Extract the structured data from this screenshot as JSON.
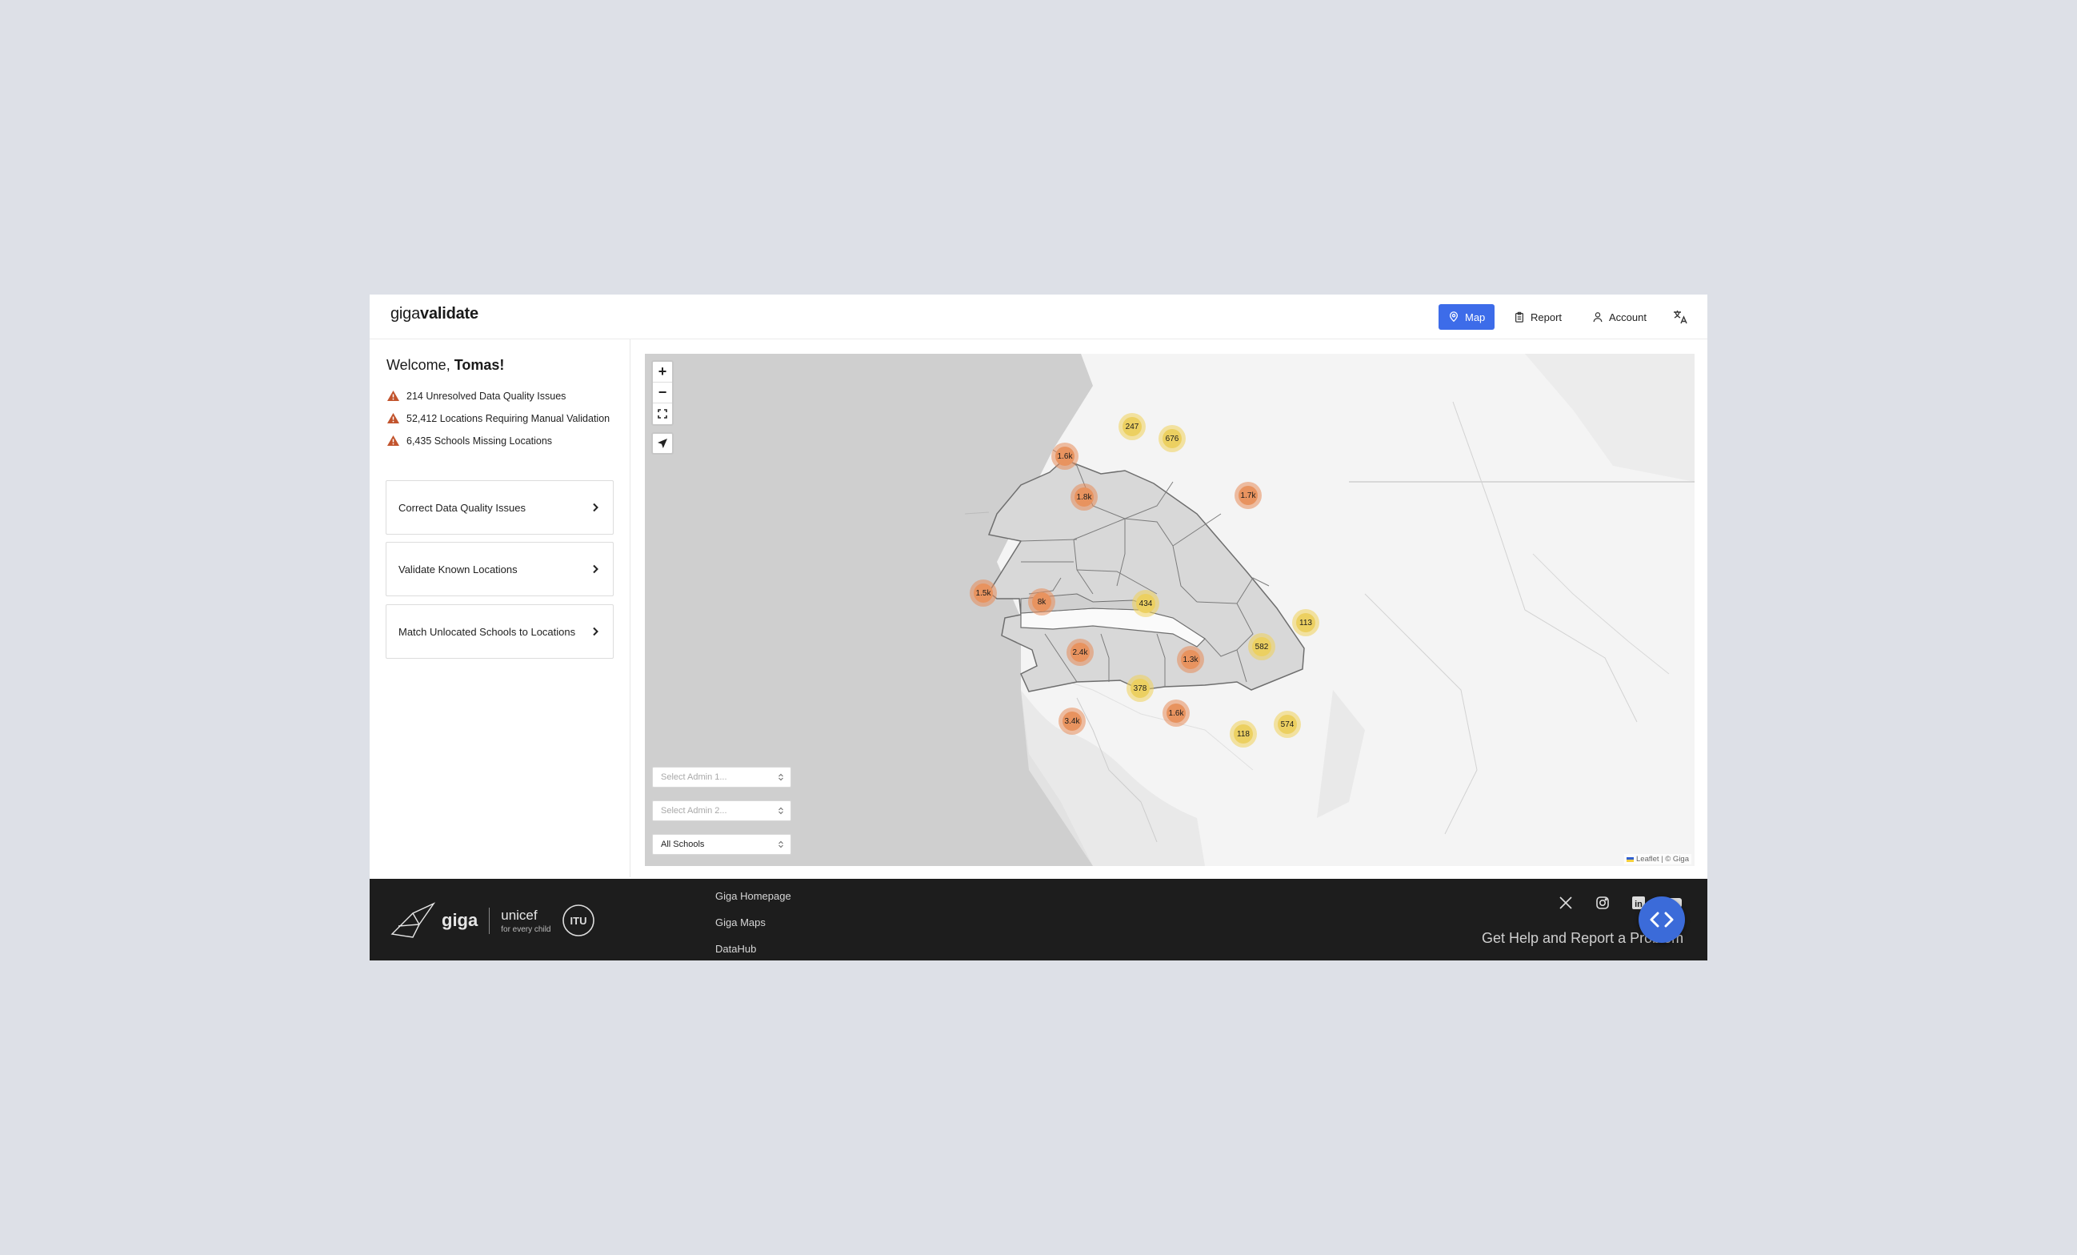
{
  "header": {
    "logo_light": "giga",
    "logo_bold": "validate",
    "nav": [
      {
        "label": "Map",
        "icon": "map-icon",
        "active": true
      },
      {
        "label": "Report",
        "icon": "clipboard-icon"
      },
      {
        "label": "Account",
        "icon": "user-icon"
      }
    ],
    "language_icon": "translate-icon",
    "accent_color": "#3d6ce9"
  },
  "sidebar": {
    "welcome_prefix": "Welcome,",
    "user_name": "Tomas!",
    "alerts": [
      "214 Unresolved Data Quality Issues",
      "52,412 Locations Requiring Manual Validation",
      "6,435 Schools Missing Locations"
    ],
    "alert_color": "#c2542d",
    "tasks": [
      "Correct Data Quality Issues",
      "Validate Known Locations",
      "Match Unlocated Schools to Locations"
    ]
  },
  "map": {
    "zoom_in": "+",
    "zoom_out": "−",
    "clusters": [
      {
        "label": "247",
        "color": "yellow"
      },
      {
        "label": "676",
        "color": "yellow"
      },
      {
        "label": "1.6k",
        "color": "orange"
      },
      {
        "label": "1.8k",
        "color": "orange"
      },
      {
        "label": "1.7k",
        "color": "orange"
      },
      {
        "label": "1.5k",
        "color": "orange"
      },
      {
        "label": "8k",
        "color": "orange"
      },
      {
        "label": "434",
        "color": "yellow"
      },
      {
        "label": "113",
        "color": "yellow"
      },
      {
        "label": "582",
        "color": "yellow"
      },
      {
        "label": "2.4k",
        "color": "orange"
      },
      {
        "label": "1.3k",
        "color": "orange"
      },
      {
        "label": "378",
        "color": "yellow"
      },
      {
        "label": "3.4k",
        "color": "orange"
      },
      {
        "label": "1.6k",
        "color": "orange"
      },
      {
        "label": "118",
        "color": "yellow"
      },
      {
        "label": "574",
        "color": "yellow"
      }
    ],
    "select_admin1_placeholder": "Select Admin 1...",
    "select_admin2_placeholder": "Select Admin 2...",
    "select_schools_value": "All Schools",
    "attribution": "Leaflet | © Giga"
  },
  "footer": {
    "giga_logo": "giga",
    "unicef_logo": "unicef",
    "unicef_tagline": "for every child",
    "itu_logo": "ITU",
    "links": [
      "Giga Homepage",
      "Giga Maps",
      "DataHub"
    ],
    "socials": [
      "x-icon",
      "instagram-icon",
      "linkedin-icon",
      "youtube-icon"
    ],
    "help_link": "Get Help and Report a Problem"
  }
}
